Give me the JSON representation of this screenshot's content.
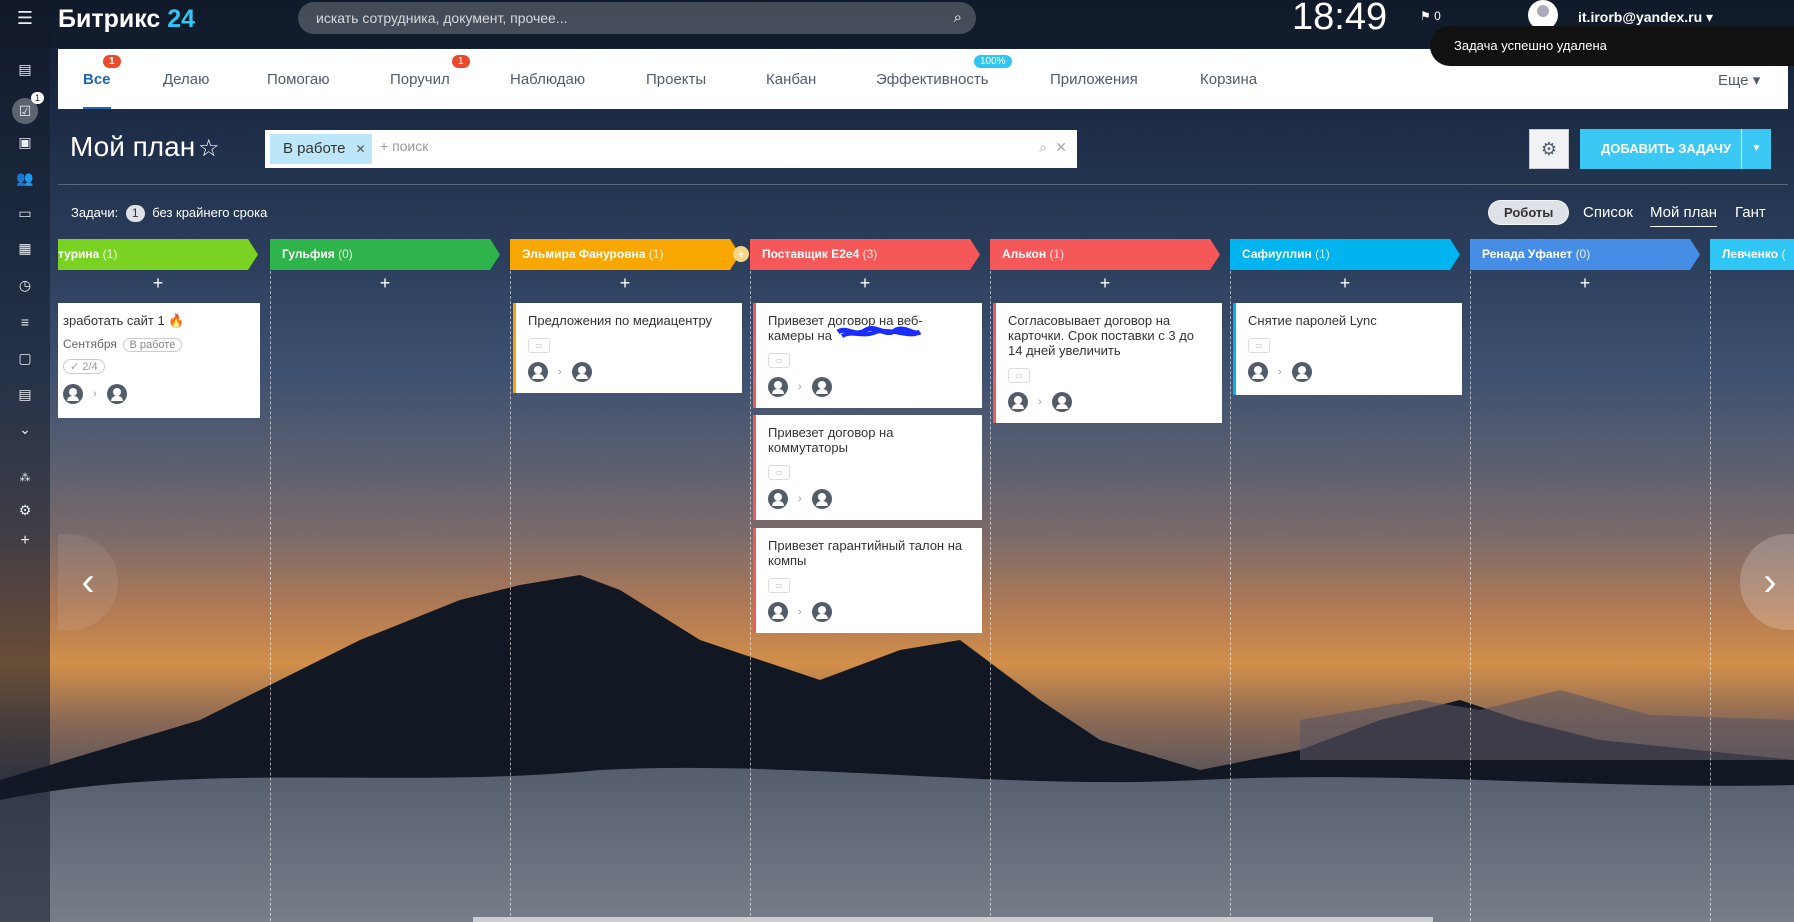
{
  "header": {
    "logo_main": "Битрикс",
    "logo_num": "24",
    "search_placeholder": "искать сотрудника, документ, прочее...",
    "clock": "18:49",
    "flag_count": "0",
    "user_email": "it.irorb@yandex.ru",
    "toast": "Задача успешно удалена"
  },
  "leftbar": {
    "tasks_badge": "1"
  },
  "tabs": [
    {
      "label": "Все",
      "badge": "1"
    },
    {
      "label": "Делаю"
    },
    {
      "label": "Помогаю"
    },
    {
      "label": "Поручил",
      "badge": "1"
    },
    {
      "label": "Наблюдаю"
    },
    {
      "label": "Проекты"
    },
    {
      "label": "Канбан"
    },
    {
      "label": "Эффективность",
      "badge": "100%"
    },
    {
      "label": "Приложения"
    },
    {
      "label": "Корзина"
    },
    {
      "label": "Еще"
    }
  ],
  "title": "Мой план",
  "filter": {
    "chip": "В работе",
    "placeholder": "+ поиск"
  },
  "add_button": "ДОБАВИТЬ ЗАДАЧУ",
  "counters": {
    "label": "Задачи:",
    "count": "1",
    "text": "без крайнего срока"
  },
  "views": {
    "robots": "Роботы",
    "list": "Список",
    "myplan": "Мой план",
    "gantt": "Гант"
  },
  "columns": [
    {
      "name": "турина",
      "count": "(1)",
      "color": "#7ad322"
    },
    {
      "name": "Гульфия",
      "count": "(0)",
      "color": "#2fb44b"
    },
    {
      "name": "Эльмира Фануровна",
      "count": "(1)",
      "color": "#f7a700"
    },
    {
      "name": "Поставщик Е2е4",
      "count": "(3)",
      "color": "#f55858"
    },
    {
      "name": "Алькон",
      "count": "(1)",
      "color": "#f55858"
    },
    {
      "name": "Сафиуллин",
      "count": "(1)",
      "color": "#00b4f0"
    },
    {
      "name": "Ренада Уфанет",
      "count": "(0)",
      "color": "#468ee5"
    },
    {
      "name": "Левченко",
      "count": "(",
      "color": "#2fc6f6"
    }
  ],
  "cards": {
    "c1_title": "зработать сайт 1",
    "c1_date": "Сентября",
    "c1_status": "В работе",
    "c1_check": "2/4",
    "c3_title": "Предложения по медиацентру",
    "c4a_title": "Привезет договор на веб-камеры на",
    "c4b_title": "Привезет договор на коммутаторы",
    "c4c_title": "Привезет гарантийный талон на компы",
    "c5_title": "Согласовывает договор на карточки. Срок поставки с 3 до 14 дней увеличить",
    "c6_title": "Снятие паролей Lync"
  },
  "colors": {
    "accent": "#3bc8f5",
    "tab_active": "#2066b0",
    "badge_red": "#e84a2b"
  }
}
